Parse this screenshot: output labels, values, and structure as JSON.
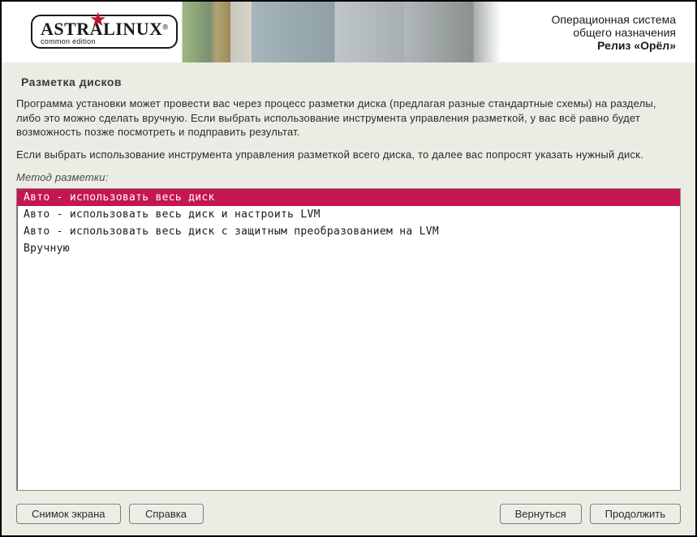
{
  "branding": {
    "logo_text": "ASTRALINUX",
    "logo_reg": "®",
    "logo_sub": "common edition",
    "line1": "Операционная система",
    "line2": "общего назначения",
    "line3": "Релиз «Орёл»"
  },
  "page": {
    "title": "Разметка дисков",
    "description1": "Программа установки может провести вас через процесс разметки диска (предлагая разные стандартные схемы) на разделы, либо это можно сделать вручную. Если выбрать использование инструмента управления разметкой, у вас всё равно будет возможность позже посмотреть и подправить результат.",
    "description2": "Если выбрать использование инструмента управления разметкой всего диска, то далее вас попросят указать нужный диск.",
    "method_label": "Метод разметки:"
  },
  "options": [
    "Авто - использовать весь диск",
    "Авто - использовать весь диск и настроить LVM",
    "Авто - использовать весь диск с защитным преобразованием на LVM",
    "Вручную"
  ],
  "selected_index": 0,
  "buttons": {
    "screenshot": "Снимок экрана",
    "help": "Справка",
    "back": "Вернуться",
    "continue": "Продолжить"
  }
}
